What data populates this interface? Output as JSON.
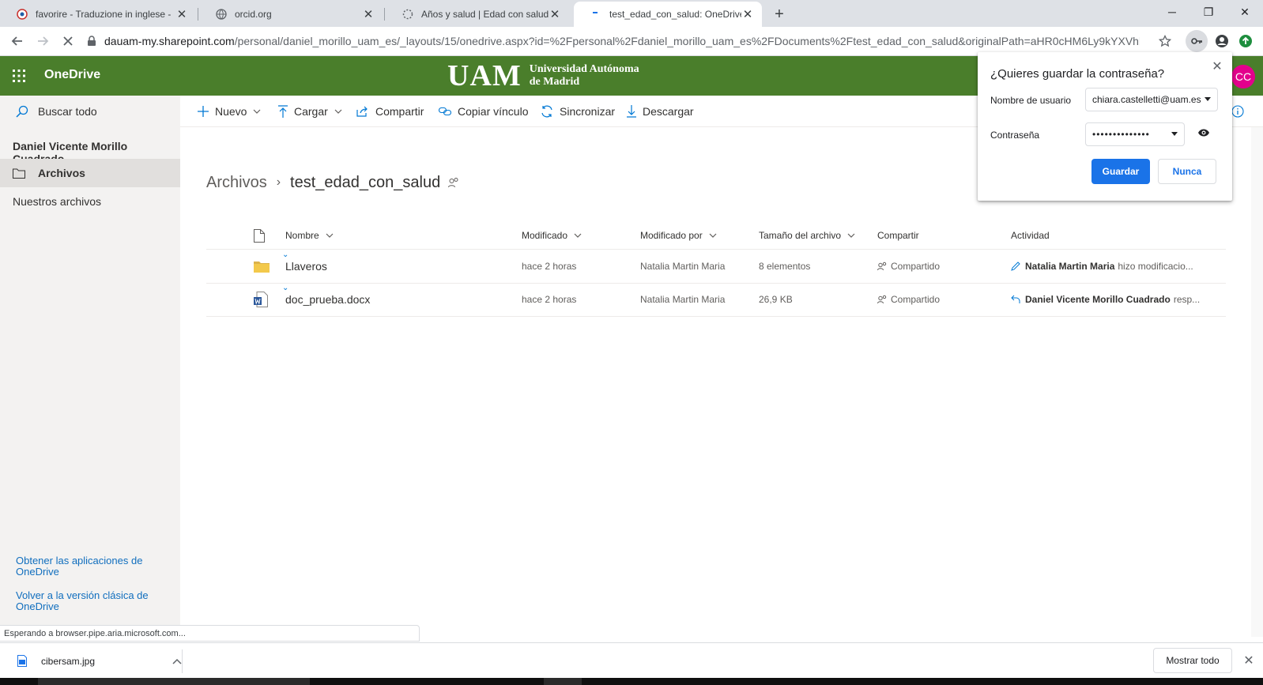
{
  "browser": {
    "tabs": [
      {
        "title": "favorire - Traduzione in inglese -",
        "icon": "reverso-icon"
      },
      {
        "title": "orcid.org",
        "icon": "globe-icon"
      },
      {
        "title": "Años y salud | Edad con salud",
        "icon": "loading-icon"
      },
      {
        "title": "test_edad_con_salud: OneDrive",
        "icon": "onedrive-icon",
        "active": true
      }
    ],
    "url_host": "dauam-my.sharepoint.com",
    "url_path": "/personal/daniel_morillo_uam_es/_layouts/15/onedrive.aspx?id=%2Fpersonal%2Fdaniel_morillo_uam_es%2FDocuments%2Ftest_edad_con_salud&originalPath=aHR0cHM6Ly9kYXVhbS..."
  },
  "header": {
    "app_name": "OneDrive",
    "org_mark": "UAM",
    "org_line1": "Universidad Autónoma",
    "org_line2": "de Madrid",
    "avatar_initials": "CC",
    "brand_color": "#4a7e2b"
  },
  "leftnav": {
    "search": "Buscar todo",
    "user": "Daniel Vicente Morillo Cuadrado",
    "items": [
      {
        "label": "Archivos",
        "selected": true
      },
      {
        "label": "Nuestros archivos",
        "selected": false
      }
    ],
    "links": [
      "Obtener las aplicaciones de OneDrive",
      "Volver a la versión clásica de OneDrive"
    ]
  },
  "commands": {
    "new": "Nuevo",
    "upload": "Cargar",
    "share": "Compartir",
    "copy_link": "Copiar vínculo",
    "sync": "Sincronizar",
    "download": "Descargar"
  },
  "breadcrumb": {
    "root": "Archivos",
    "current": "test_edad_con_salud"
  },
  "columns": {
    "name": "Nombre",
    "modified": "Modificado",
    "modified_by": "Modificado por",
    "size": "Tamaño del archivo",
    "sharing": "Compartir",
    "activity": "Actividad"
  },
  "files": [
    {
      "name": "Llaveros",
      "type": "folder",
      "modified": "hace 2 horas",
      "modified_by": "Natalia Martin Maria",
      "size": "8 elementos",
      "sharing": "Compartido",
      "activity_user": "Natalia Martin Maria",
      "activity_text": "hizo modificacio...",
      "activity_icon": "pencil-icon"
    },
    {
      "name": "doc_prueba.docx",
      "type": "word",
      "modified": "hace 2 horas",
      "modified_by": "Natalia Martin Maria",
      "size": "26,9 KB",
      "sharing": "Compartido",
      "activity_user": "Daniel Vicente Morillo Cuadrado",
      "activity_text": "resp...",
      "activity_icon": "reply-icon"
    }
  ],
  "password_prompt": {
    "title": "¿Quieres guardar la contraseña?",
    "username_label": "Nombre de usuario",
    "username_value": "chiara.castelletti@uam.es",
    "password_label": "Contraseña",
    "password_value": "••••••••••••••",
    "save": "Guardar",
    "never": "Nunca"
  },
  "status": {
    "loading_text": "Esperando a browser.pipe.aria.microsoft.com..."
  },
  "downloads": {
    "file": "cibersam.jpg",
    "show_all": "Mostrar todo"
  }
}
